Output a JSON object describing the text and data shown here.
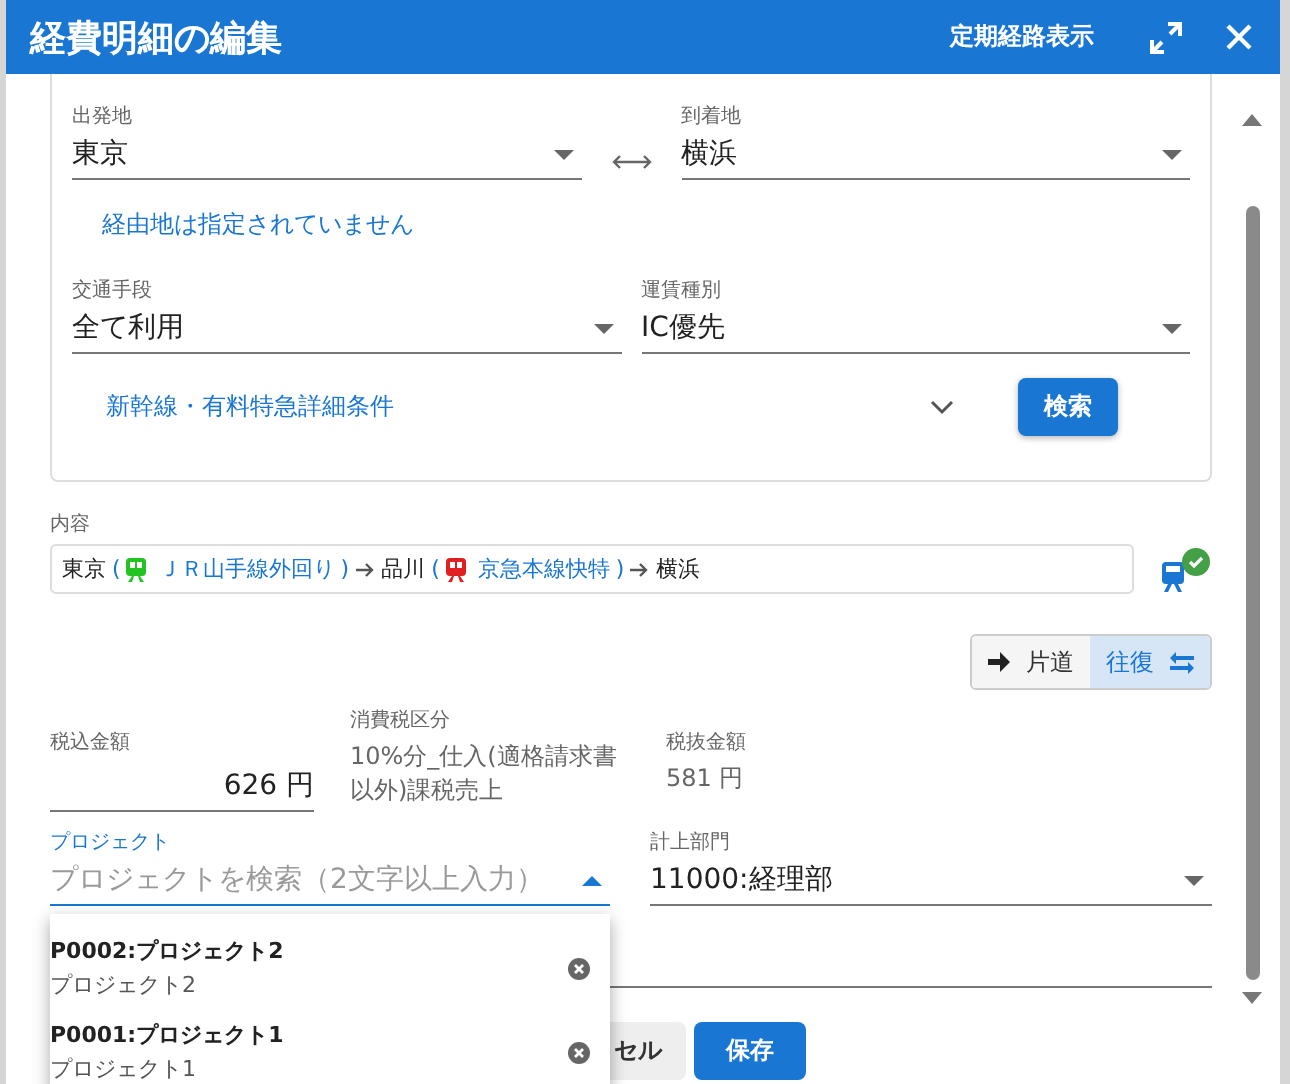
{
  "dialog": {
    "title": "経費明細の編集",
    "header_link": "定期経路表示"
  },
  "search": {
    "origin": {
      "label": "出発地",
      "value": "東京"
    },
    "destination": {
      "label": "到着地",
      "value": "横浜"
    },
    "via_link": "経由地は指定されていません",
    "transport": {
      "label": "交通手段",
      "value": "全て利用"
    },
    "fare_type": {
      "label": "運賃種別",
      "value": "IC優先"
    },
    "details_link": "新幹線・有料特急詳細条件",
    "expanded": false,
    "search_button": "検索"
  },
  "route": {
    "label": "内容",
    "segments": [
      {
        "kind": "station",
        "name": "東京"
      },
      {
        "kind": "line",
        "open": "(",
        "name": "ＪＲ山手線外回り",
        "close": ")",
        "color": "#22c422"
      },
      {
        "kind": "station",
        "name": "品川"
      },
      {
        "kind": "line",
        "open": "(",
        "name": "京急本線快特",
        "close": ")",
        "color": "#e02020"
      },
      {
        "kind": "station",
        "name": "横浜"
      }
    ],
    "verified": true
  },
  "trip": [
    {
      "kind": "one_way",
      "label": "片道",
      "selected": false
    },
    {
      "kind": "round_trip",
      "label": "往復",
      "selected": true
    }
  ],
  "amount": {
    "label": "税込金額",
    "value": "626 円"
  },
  "tax_category": {
    "label": "消費税区分",
    "value": "10%分_仕入(適格請求書以外)課税売上"
  },
  "net_amount": {
    "label": "税抜金額",
    "value": "581 円"
  },
  "project": {
    "label": "プロジェクト",
    "placeholder": "プロジェクトを検索（2文字以上入力）",
    "focused": true,
    "open": true,
    "options": [
      {
        "code": "P0002:プロジェクト2",
        "name": "プロジェクト2"
      },
      {
        "code": "P0001:プロジェクト1",
        "name": "プロジェクト1"
      }
    ]
  },
  "department": {
    "label": "計上部門",
    "value": "11000:経理部"
  },
  "buttons": [
    {
      "kind": "cancel",
      "label": "セル"
    },
    {
      "kind": "save",
      "label": "保存"
    }
  ]
}
